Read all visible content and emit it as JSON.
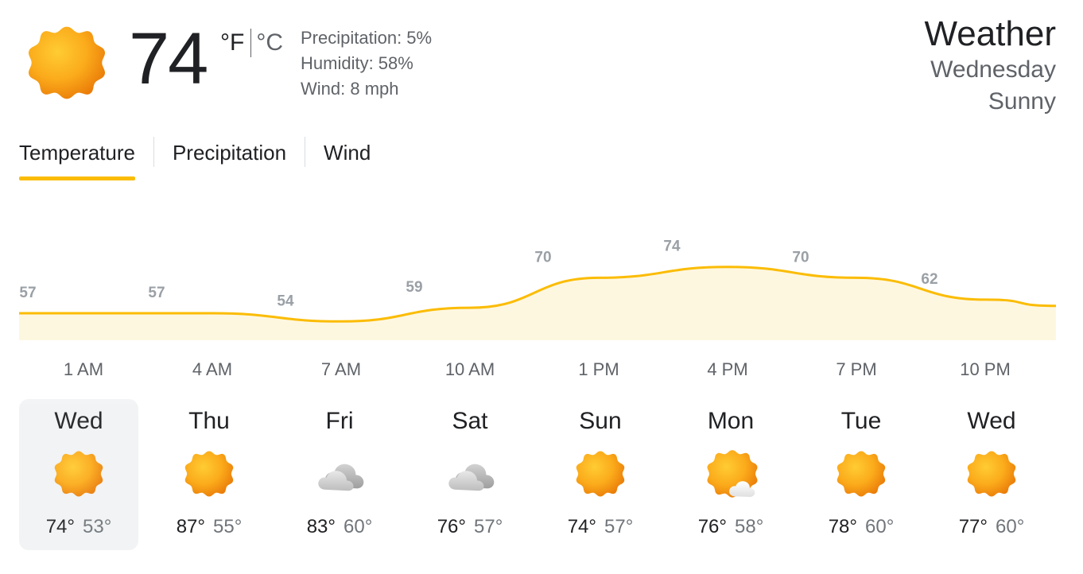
{
  "current": {
    "temp": "74",
    "unit_f": "°F",
    "unit_c": "°C",
    "precipitation": "Precipitation: 5%",
    "humidity": "Humidity: 58%",
    "wind": "Wind: 8 mph",
    "icon": "sun-icon"
  },
  "header": {
    "title": "Weather",
    "day": "Wednesday",
    "condition": "Sunny"
  },
  "tabs": [
    {
      "label": "Temperature",
      "active": true
    },
    {
      "label": "Precipitation",
      "active": false
    },
    {
      "label": "Wind",
      "active": false
    }
  ],
  "colors": {
    "accent": "#fbbc04",
    "chart_fill": "#fef7e0",
    "chart_label": "#9aa0a6"
  },
  "chart_data": {
    "type": "area",
    "x": [
      "1 AM",
      "4 AM",
      "7 AM",
      "10 AM",
      "1 PM",
      "4 PM",
      "7 PM",
      "10 PM"
    ],
    "y": [
      57,
      57,
      54,
      59,
      70,
      74,
      70,
      62
    ],
    "labels": [
      "57",
      "57",
      "54",
      "59",
      "70",
      "74",
      "70",
      "62"
    ]
  },
  "days": [
    {
      "name": "Wed",
      "high": "74°",
      "low": "53°",
      "icon": "sun-icon",
      "selected": true
    },
    {
      "name": "Thu",
      "high": "87°",
      "low": "55°",
      "icon": "sun-icon",
      "selected": false
    },
    {
      "name": "Fri",
      "high": "83°",
      "low": "60°",
      "icon": "cloud-icon",
      "selected": false
    },
    {
      "name": "Sat",
      "high": "76°",
      "low": "57°",
      "icon": "cloud-icon",
      "selected": false
    },
    {
      "name": "Sun",
      "high": "74°",
      "low": "57°",
      "icon": "sun-icon",
      "selected": false
    },
    {
      "name": "Mon",
      "high": "76°",
      "low": "58°",
      "icon": "partly-cloudy-icon",
      "selected": false
    },
    {
      "name": "Tue",
      "high": "78°",
      "low": "60°",
      "icon": "sun-icon",
      "selected": false
    },
    {
      "name": "Wed",
      "high": "77°",
      "low": "60°",
      "icon": "sun-icon",
      "selected": false
    }
  ]
}
